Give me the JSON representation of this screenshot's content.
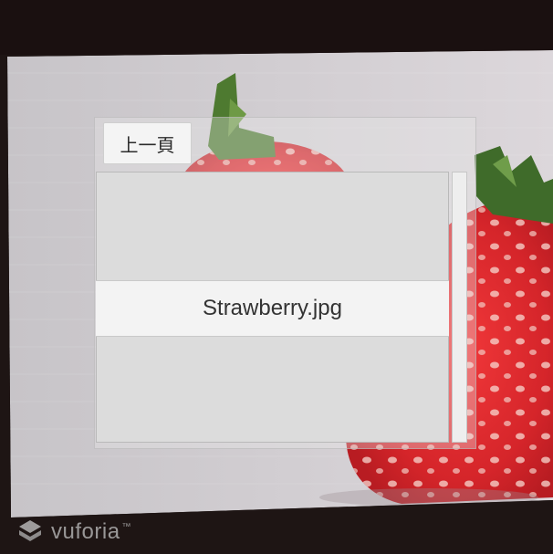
{
  "panel": {
    "prev_button_label": "上一頁",
    "list_items": [
      "Strawberry.jpg"
    ]
  },
  "watermark": {
    "brand": "vuforia",
    "mark": "™"
  },
  "colors": {
    "panel_bg": "#dcdcdc",
    "selected_item": "#f3f3f3",
    "strawberry_red": "#e02a2e"
  },
  "icons": [
    "vuforia-logo-icon"
  ]
}
